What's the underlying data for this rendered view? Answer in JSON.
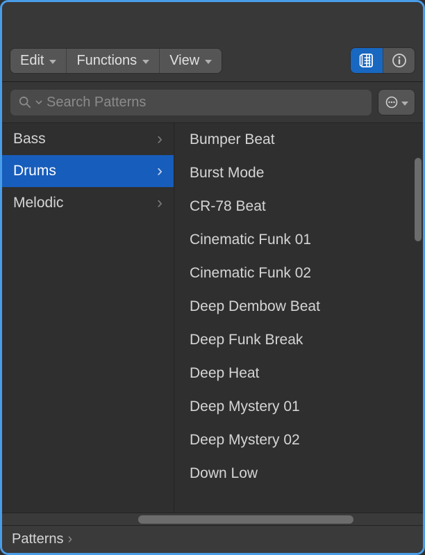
{
  "toolbar": {
    "edit": "Edit",
    "functions": "Functions",
    "view": "View"
  },
  "search": {
    "placeholder": "Search Patterns"
  },
  "categories": [
    {
      "label": "Bass",
      "selected": false
    },
    {
      "label": "Drums",
      "selected": true
    },
    {
      "label": "Melodic",
      "selected": false
    }
  ],
  "patterns": [
    "Bumper Beat",
    "Burst Mode",
    "CR-78 Beat",
    "Cinematic Funk 01",
    "Cinematic Funk 02",
    "Deep Dembow Beat",
    "Deep Funk Break",
    "Deep Heat",
    "Deep Mystery 01",
    "Deep Mystery 02",
    "Down Low"
  ],
  "breadcrumb": {
    "root": "Patterns"
  }
}
